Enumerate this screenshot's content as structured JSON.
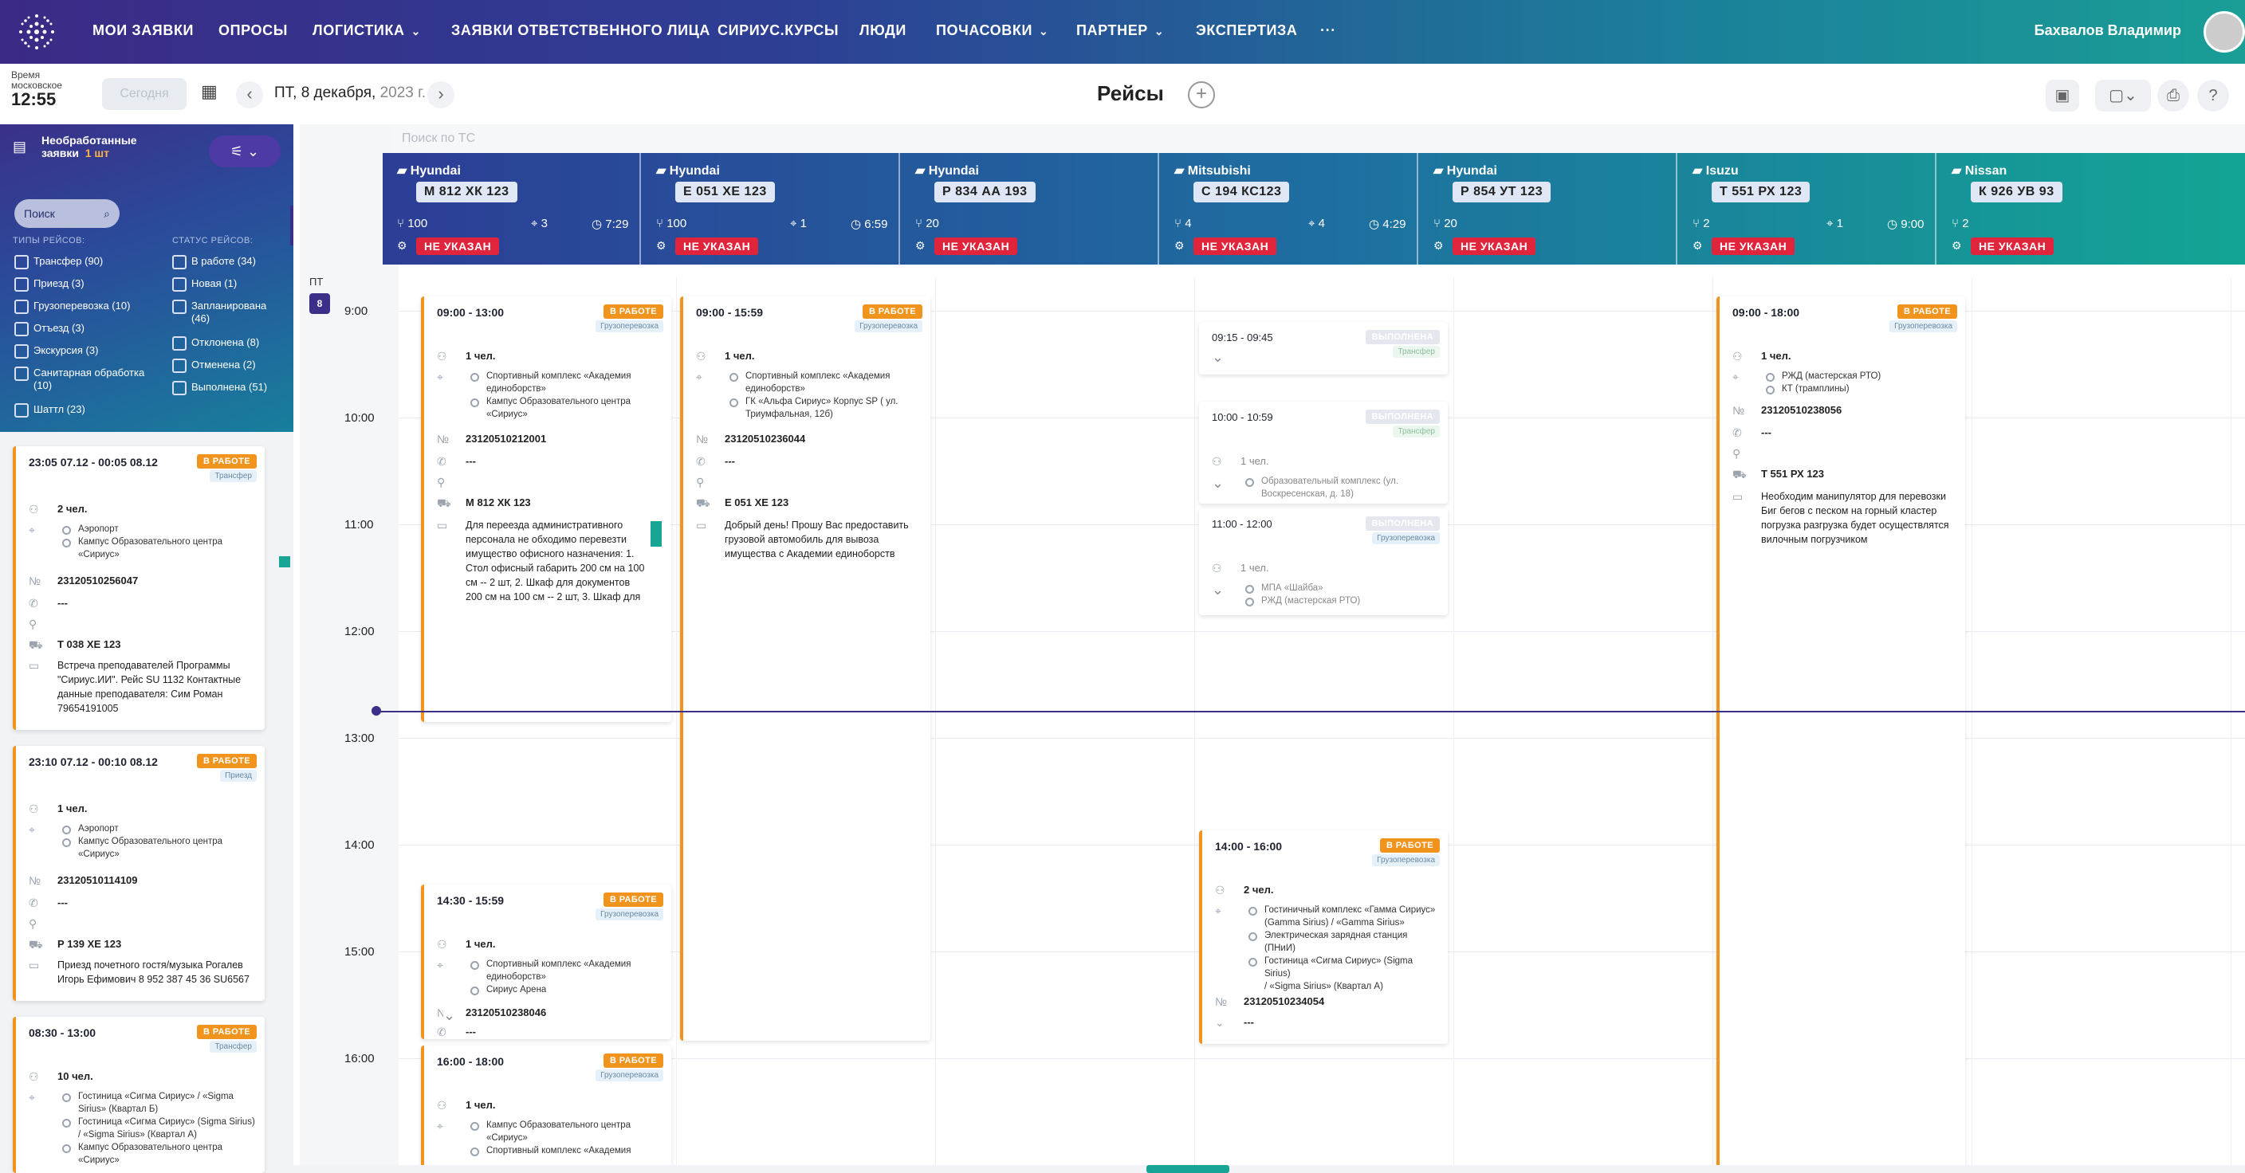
{
  "nav": {
    "items": [
      "МОИ ЗАЯВКИ",
      "ОПРОСЫ",
      "ЛОГИСТИКА",
      "ЗАЯВКИ ОТВЕТСТВЕННОГО ЛИЦА",
      "СИРИУС.КУРСЫ",
      "ЛЮДИ",
      "ПОЧАСОВКИ",
      "ПАРТНЕР",
      "ЭКСПЕРТИЗА",
      "···"
    ],
    "user": "Бахвалов Владимир"
  },
  "toolbar": {
    "time_label_1": "Время",
    "time_label_2": "московское",
    "time": "12:55",
    "today": "Сегодня",
    "date_main": "ПТ, 8 декабря,",
    "date_year": "2023 г.",
    "title": "Рейсы"
  },
  "sidebar": {
    "title1": "Необработанные",
    "title2": "заявки",
    "count": "1 шт",
    "search": "Поиск",
    "types_head": "ТИПЫ РЕЙСОВ:",
    "status_head": "СТАТУС РЕЙСОВ:",
    "types": [
      "Трансфер (90)",
      "Приезд (3)",
      "Грузоперевозка (10)",
      "Отъезд (3)",
      "Экскурсия (3)",
      "Санитарная обработка",
      "(10)",
      "Шаттл (23)"
    ],
    "statuses": [
      "В работе (34)",
      "Новая (1)",
      "Запланирована",
      "(46)",
      "Отклонена (8)",
      "Отменена (2)",
      "Выполнена (51)"
    ]
  },
  "requests": [
    {
      "time": "23:05 07.12 - 00:05 08.12",
      "badge": "В РАБОТЕ",
      "type": "Трансфер",
      "people": "2 чел.",
      "from": "Аэропорт",
      "to1": "Кампус Образовательного центра",
      "to2": "«Сириус»",
      "num": "23120510256047",
      "phone": "---",
      "car": "Т 038 ХЕ 123",
      "note1": "Встреча преподавателей Программы",
      "note2": "\"Сириус.ИИ\". Рейс SU 1132 Контактные",
      "note3": "данные преподавателя: Сим Роман",
      "note4": "79654191005"
    },
    {
      "time": "23:10 07.12 - 00:10 08.12",
      "badge": "В РАБОТЕ",
      "type": "Приезд",
      "people": "1 чел.",
      "from": "Аэропорт",
      "to1": "Кампус Образовательного центра",
      "to2": "«Сириус»",
      "num": "23120510114109",
      "phone": "---",
      "car": "Р 139 ХЕ 123",
      "note1": "Приезд почетного гостя/музыка Рогалев",
      "note2": "Игорь Ефимович 8 952 387 45 36 SU6567"
    },
    {
      "time": "08:30 - 13:00",
      "badge": "В РАБОТЕ",
      "type": "Трансфер",
      "people": "10 чел.",
      "a1": "Гостиница «Сигма Сириус» / «Sigma",
      "a2": "Sirius» (Квартал Б)",
      "a3": "Гостиница «Сигма Сириус» (Sigma Sirius)",
      "a4": "/ «Sigma Sirius» (Квартал А)",
      "a5": "Кампус Образовательного центра",
      "a6": "«Сириус»"
    }
  ],
  "hours": [
    "9:00",
    "10:00",
    "11:00",
    "12:00",
    "13:00",
    "14:00",
    "15:00",
    "16:00"
  ],
  "day": {
    "label": "ПТ",
    "num": "8"
  },
  "ts_search": "Поиск по ТС",
  "vehicles": [
    {
      "name": "Hyundai",
      "plate": "М 812 ХК 123",
      "seats": "100",
      "cnt": "3",
      "hours": "7:29",
      "status": "НЕ УКАЗАН"
    },
    {
      "name": "Hyundai",
      "plate": "Е 051 ХЕ 123",
      "seats": "100",
      "cnt": "1",
      "hours": "6:59",
      "status": "НЕ УКАЗАН"
    },
    {
      "name": "Hyundai",
      "plate": "Р 834 АА 193",
      "seats": "20",
      "cnt": "",
      "hours": "",
      "status": "НЕ УКАЗАН"
    },
    {
      "name": "Mitsubishi",
      "plate": "С 194 КС123",
      "seats": "4",
      "cnt": "4",
      "hours": "4:29",
      "status": "НЕ УКАЗАН"
    },
    {
      "name": "Hyundai",
      "plate": "Р 854 УТ 123",
      "seats": "20",
      "cnt": "",
      "hours": "",
      "status": "НЕ УКАЗАН"
    },
    {
      "name": "Isuzu",
      "plate": "Т 551 РХ 123",
      "seats": "2",
      "cnt": "1",
      "hours": "9:00",
      "status": "НЕ УКАЗАН"
    },
    {
      "name": "Nissan",
      "plate": "К 926 УВ 93",
      "seats": "2",
      "cnt": "",
      "hours": "",
      "status": "НЕ УКАЗАН"
    }
  ],
  "trips": {
    "t1": {
      "time": "09:00 - 13:00",
      "badge": "В РАБОТЕ",
      "type": "Грузоперевозка",
      "people": "1 чел.",
      "a1": "Спортивный комплекс «Академия",
      "a2": "единоборств»",
      "a3": "Кампус Образовательного центра",
      "a4": "«Сириус»",
      "num": "23120510212001",
      "phone": "---",
      "car": "М 812 ХК 123",
      "n1": "Для переезда административного",
      "n2": "персонала не обходимо перевезти",
      "n3": "имущество офисного назначения: 1.",
      "n4": "Стол офисный габарить 200 см на 100",
      "n5": "см -- 2 шт, 2. Шкаф для документов",
      "n6": "200 см на 100 см -- 2 шт, 3. Шкаф для"
    },
    "t2": {
      "time": "09:00 - 15:59",
      "badge": "В РАБОТЕ",
      "type": "Грузоперевозка",
      "people": "1 чел.",
      "a1": "Спортивный комплекс «Академия",
      "a2": "единоборств»",
      "a3": "ГК «Альфа Сириус» Корпус SP ( ул.",
      "a4": "Триумфальная, 12б)",
      "num": "23120510236044",
      "phone": "---",
      "car": "Е 051 ХЕ 123",
      "n1": "Добрый день! Прошу Вас предоставить",
      "n2": "грузовой автомобиль для вывоза",
      "n3": "имущества с Академии единоборств"
    },
    "t3": {
      "time": "09:15 - 09:45",
      "badge": "ВЫПОЛНЕНА",
      "type": "Трансфер"
    },
    "t4": {
      "time": "10:00 - 10:59",
      "badge": "ВЫПОЛНЕНА",
      "type": "Трансфер",
      "people": "1 чел.",
      "a1": "Образовательный комплекс (ул.",
      "a2": "Воскресенская, д. 18)"
    },
    "t5": {
      "time": "11:00 - 12:00",
      "badge": "ВЫПОЛНЕНА",
      "type": "Грузоперевозка",
      "people": "1 чел.",
      "a1": "МПА «Шайба»",
      "a2": "РЖД (мастерская РТО)"
    },
    "t6": {
      "time": "09:00 - 18:00",
      "badge": "В РАБОТЕ",
      "type": "Грузоперевозка",
      "people": "1 чел.",
      "a1": "РЖД (мастерская РТО)",
      "a2": "КТ (трамплины)",
      "num": "23120510238056",
      "phone": "---",
      "car": "Т 551 РХ 123",
      "n1": "Необходим манипулятор для перевозки",
      "n2": "Биг бегов с песком на горный кластер",
      "n3": "погрузка разгрузка будет осуществлятся",
      "n4": "вилочным погрузчиком"
    },
    "t7": {
      "time": "14:30 - 15:59",
      "badge": "В РАБОТЕ",
      "type": "Грузоперевозка",
      "people": "1 чел.",
      "a1": "Спортивный комплекс «Академия",
      "a2": "единоборств»",
      "a3": "Сириус Арена",
      "num": "23120510238046",
      "phone": "---"
    },
    "t8": {
      "time": "14:00 - 16:00",
      "badge": "В РАБОТЕ",
      "type": "Грузоперевозка",
      "people": "2 чел.",
      "a1": "Гостиничный комплекс «Гамма Сириус»",
      "a2": "(Gamma Sirius) / «Gamma Sirius»",
      "a3": "Электрическая зарядная станция",
      "a4": "(ПНиИ)",
      "a5": "Гостиница «Сигма Сириус» (Sigma Sirius)",
      "a6": "/ «Sigma Sirius» (Квартал А)",
      "num": "23120510234054",
      "phone": "---"
    },
    "t9": {
      "time": "16:00 - 18:00",
      "badge": "В РАБОТЕ",
      "type": "Грузоперевозка",
      "people": "1 чел.",
      "a1": "Кампус Образовательного центра",
      "a2": "«Сириус»",
      "a3": "Спортивный комплекс «Академия"
    }
  },
  "colors": {
    "accent": "#3a3089",
    "teal": "#19a596",
    "work": "#f0941e",
    "alert": "#e0243c"
  },
  "icons": [
    "logo-icon",
    "calendar-icon",
    "chevron-left-icon",
    "chevron-right-icon",
    "plus-icon",
    "bus-icon",
    "export-icon",
    "print-icon",
    "help-icon",
    "filter-icon",
    "search-icon",
    "people-icon",
    "location-icon",
    "number-icon",
    "phone-icon",
    "user-icon",
    "car-icon",
    "comment-icon",
    "truck-icon",
    "seat-icon",
    "clock-icon",
    "gear-icon"
  ]
}
